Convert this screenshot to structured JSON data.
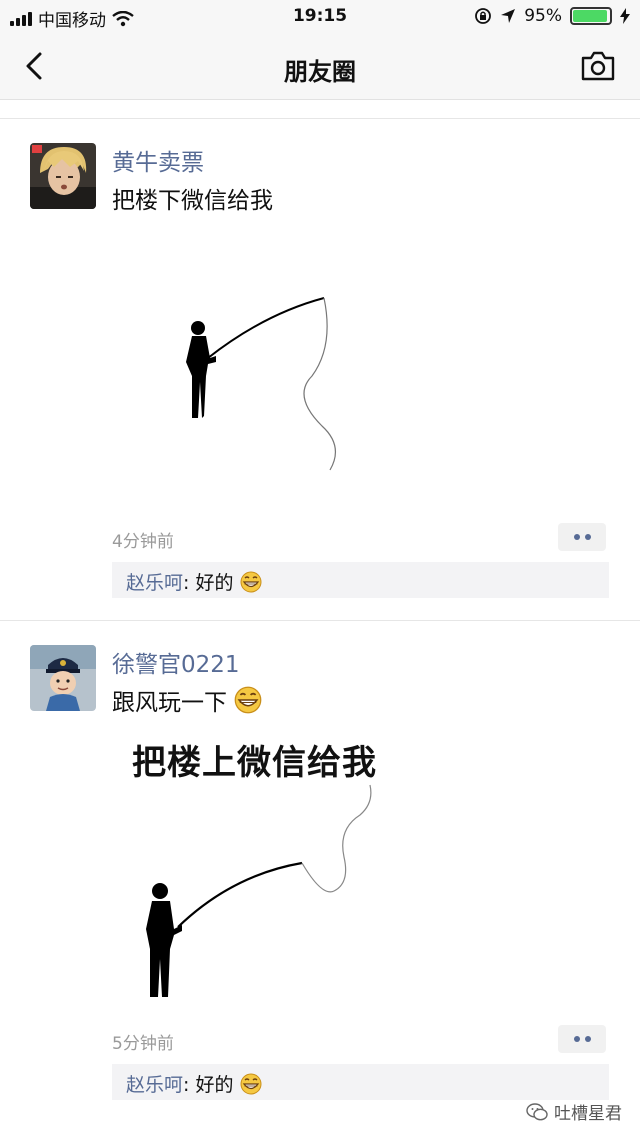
{
  "status_bar": {
    "carrier": "中国移动",
    "time": "19:15",
    "battery": "95%",
    "battery_level": 0.95
  },
  "nav": {
    "title": "朋友圈",
    "back_icon": "chevron-left-icon",
    "camera_icon": "camera-icon"
  },
  "posts": [
    {
      "username": "黄牛卖票",
      "text": "把楼下微信给我",
      "time": "4分钟前",
      "comment": {
        "author": "赵乐呵",
        "separator": ": ",
        "text": "好的"
      }
    },
    {
      "username": "徐警官0221",
      "text": "跟风玩一下",
      "meme_caption": "把楼上微信给我",
      "time": "5分钟前",
      "comment": {
        "author": "赵乐呵",
        "separator": ": ",
        "text": "好的"
      }
    }
  ],
  "watermark": {
    "text": "吐槽星君"
  },
  "colors": {
    "link": "#576b95",
    "background": "#ffffff",
    "bar": "#f7f7f7"
  }
}
